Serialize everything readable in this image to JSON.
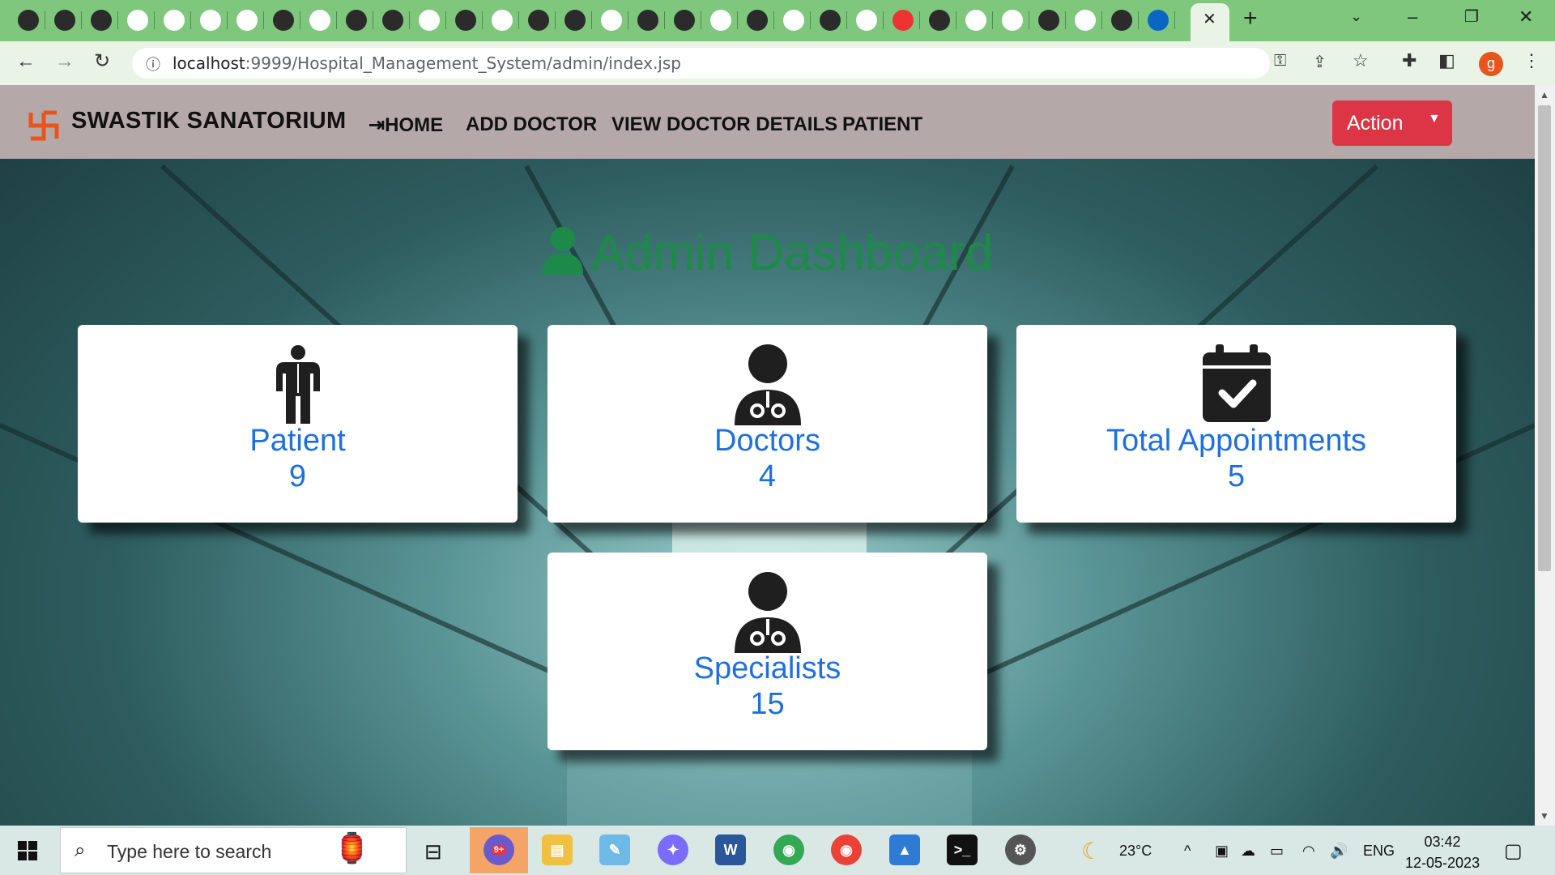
{
  "browser": {
    "url_host": "localhost",
    "url_path": ":9999/Hospital_Management_System/admin/index.jsp",
    "profile_initial": "g",
    "new_tab_glyph": "+",
    "close_tab_glyph": "✕"
  },
  "navbar": {
    "brand": "SWASTIK SANATORIUM",
    "links": [
      "HOME",
      "ADD DOCTOR",
      "VIEW DOCTOR DETAILS",
      "PATIENT"
    ],
    "action_label": "Action",
    "accent": "#dc3545"
  },
  "page": {
    "title": "Admin Dashboard",
    "title_color": "#1e8a4a"
  },
  "cards": [
    {
      "label": "Patient",
      "value": "9",
      "icon": "person-standing-icon"
    },
    {
      "label": "Doctors",
      "value": "4",
      "icon": "doctor-icon"
    },
    {
      "label": "Total Appointments",
      "value": "5",
      "icon": "calendar-check-icon"
    },
    {
      "label": "Specialists",
      "value": "15",
      "icon": "doctor-icon"
    }
  ],
  "taskbar": {
    "search_placeholder": "Type here to search",
    "weather": "23°C",
    "language": "ENG",
    "time": "03:42",
    "date": "12-05-2023",
    "badge": "9+"
  }
}
